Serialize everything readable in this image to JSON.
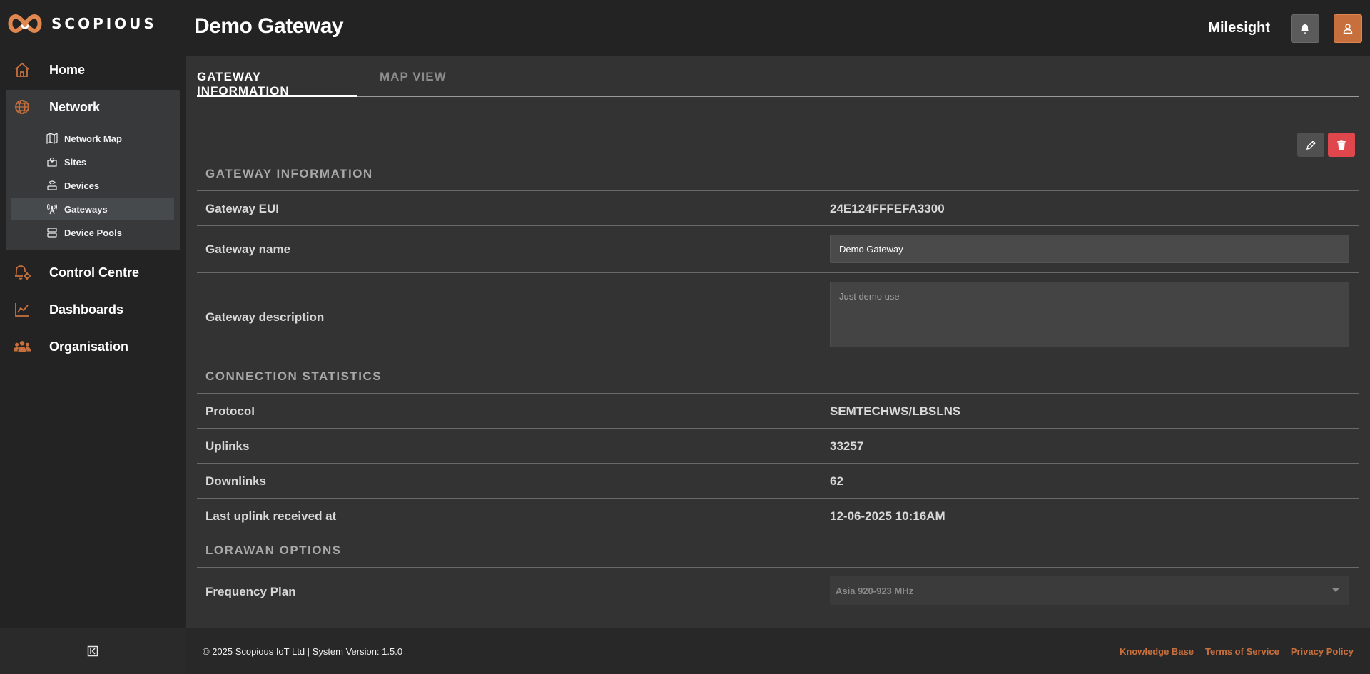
{
  "brand": {
    "name": "SCOPIOUS",
    "accent": "#c8703d",
    "danger": "#e0474c"
  },
  "sidebar": {
    "items": [
      {
        "label": "Home",
        "icon": "home-icon"
      },
      {
        "label": "Network",
        "icon": "globe-icon"
      },
      {
        "label": "Control Centre",
        "icon": "bell-gear-icon"
      },
      {
        "label": "Dashboards",
        "icon": "line-chart-icon"
      },
      {
        "label": "Organisation",
        "icon": "people-icon"
      }
    ],
    "network_sub": [
      {
        "label": "Network Map",
        "icon": "map-icon"
      },
      {
        "label": "Sites",
        "icon": "site-icon"
      },
      {
        "label": "Devices",
        "icon": "device-icon"
      },
      {
        "label": "Gateways",
        "icon": "antenna-icon",
        "active": true
      },
      {
        "label": "Device Pools",
        "icon": "pool-icon"
      }
    ],
    "collapse_icon": "collapse-sidebar-icon"
  },
  "header": {
    "title": "Demo Gateway",
    "org": "Milesight"
  },
  "tabs": [
    {
      "label": "GATEWAY INFORMATION",
      "active": true
    },
    {
      "label": "MAP VIEW",
      "active": false
    }
  ],
  "gateway_info": {
    "heading": "GATEWAY INFORMATION",
    "eui_label": "Gateway EUI",
    "eui_value": "24E124FFFEFA3300",
    "name_label": "Gateway name",
    "name_value": "Demo Gateway",
    "desc_label": "Gateway description",
    "desc_placeholder": "Just demo use"
  },
  "connection": {
    "heading": "CONNECTION STATISTICS",
    "protocol_label": "Protocol",
    "protocol_value": "SEMTECHWS/LBSLNS",
    "uplinks_label": "Uplinks",
    "uplinks_value": "33257",
    "downlinks_label": "Downlinks",
    "downlinks_value": "62",
    "last_uplink_label": "Last uplink received at",
    "last_uplink_value": "12-06-2025 10:16AM"
  },
  "lorawan": {
    "heading": "LORAWAN OPTIONS",
    "freq_label": "Frequency Plan",
    "freq_value": "Asia 920-923 MHz"
  },
  "footer": {
    "copyright": "© 2025 Scopious IoT Ltd | System Version: 1.5.0",
    "links": [
      "Knowledge Base",
      "Terms of Service",
      "Privacy Policy"
    ]
  }
}
